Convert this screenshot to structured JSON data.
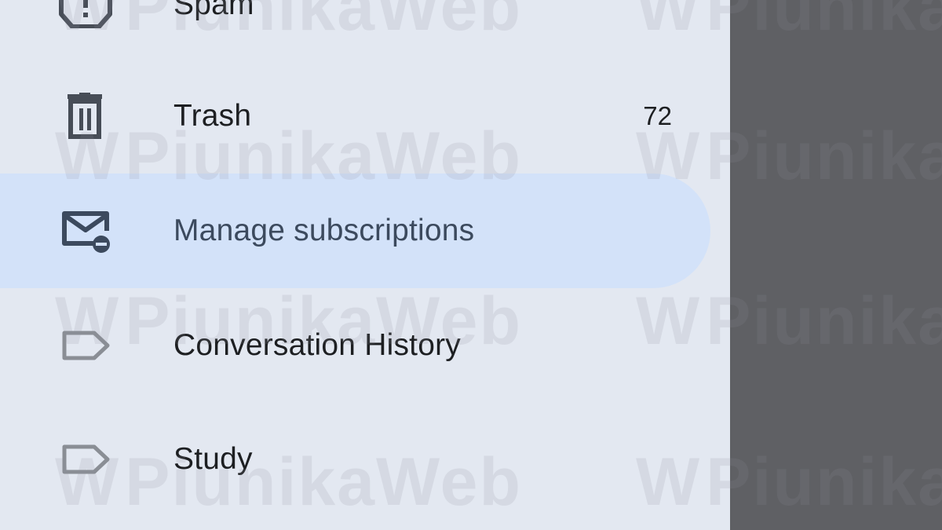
{
  "drawer": {
    "items": [
      {
        "label": "Spam",
        "icon": "spam-report-icon"
      },
      {
        "label": "Trash",
        "count": "72",
        "icon": "trash-icon"
      },
      {
        "label": "Manage subscriptions",
        "icon": "unsubscribe-mail-icon",
        "selected": true
      },
      {
        "label": "Conversation History",
        "icon": "label-icon"
      },
      {
        "label": "Study",
        "icon": "label-icon"
      }
    ]
  },
  "watermark": {
    "text": "PiunikaWeb"
  },
  "colors": {
    "drawer_background": "#e3e8f1",
    "selected_background": "#d3e2f9",
    "scrim": "#5f6064",
    "icon": "#474d57"
  }
}
